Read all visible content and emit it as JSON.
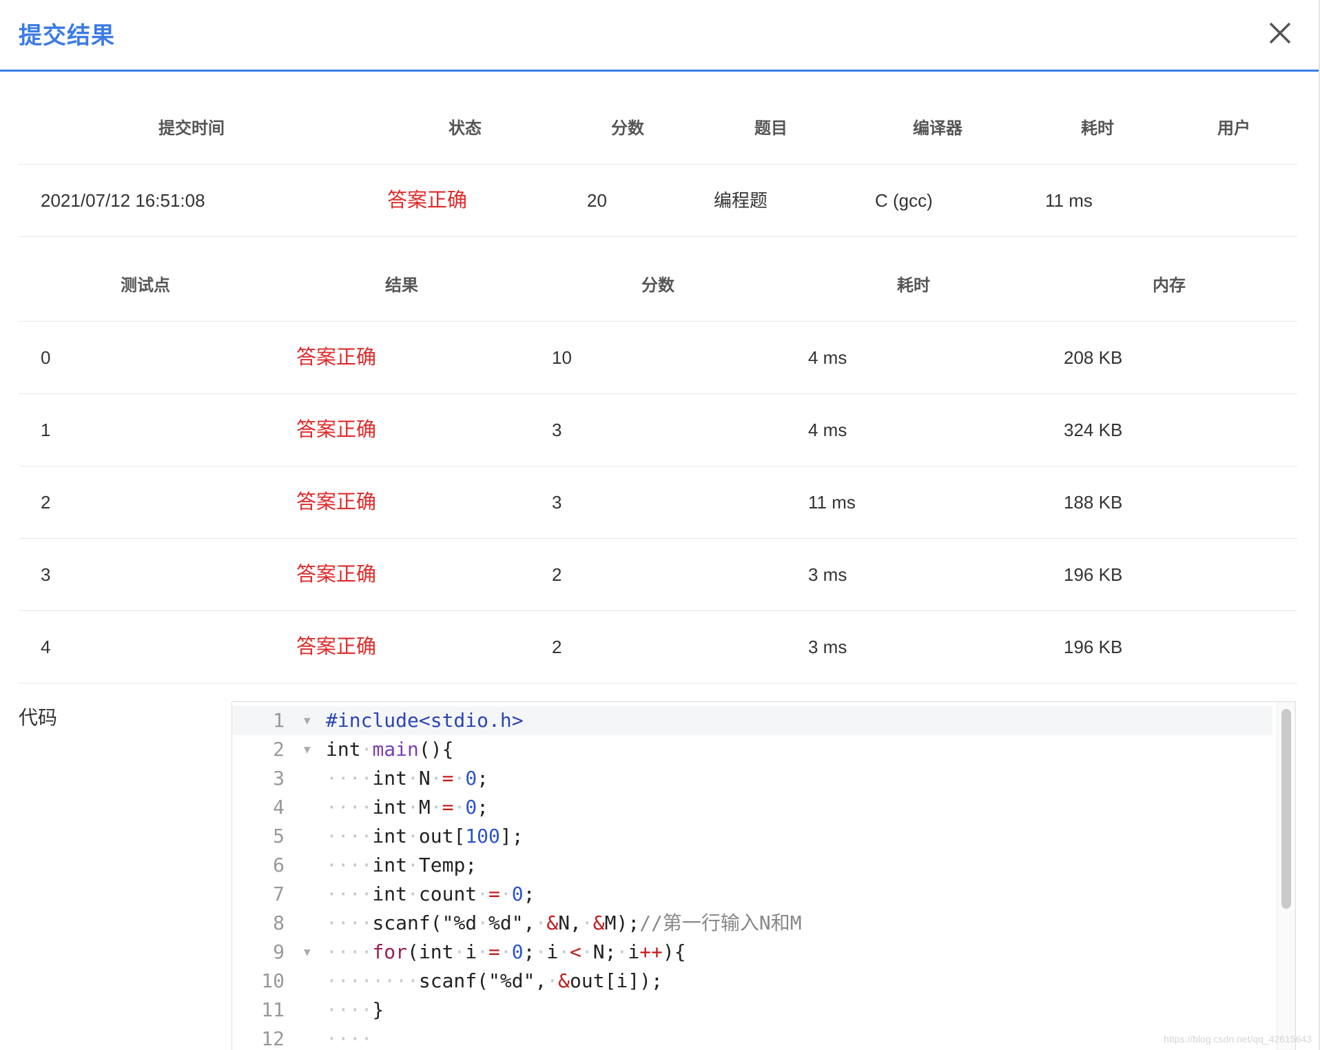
{
  "dialog": {
    "title": "提交结果",
    "close_icon": "close-icon"
  },
  "submission": {
    "headers": [
      "提交时间",
      "状态",
      "分数",
      "题目",
      "编译器",
      "耗时",
      "用户"
    ],
    "row": {
      "time": "2021/07/12 16:51:08",
      "status": "答案正确",
      "score": "20",
      "problem": "编程题",
      "compiler": "C (gcc)",
      "duration": "11 ms",
      "user": ""
    }
  },
  "testcases": {
    "headers": [
      "测试点",
      "结果",
      "分数",
      "耗时",
      "内存"
    ],
    "rows": [
      {
        "id": "0",
        "result": "答案正确",
        "score": "10",
        "time": "4 ms",
        "memory": "208 KB"
      },
      {
        "id": "1",
        "result": "答案正确",
        "score": "3",
        "time": "4 ms",
        "memory": "324 KB"
      },
      {
        "id": "2",
        "result": "答案正确",
        "score": "3",
        "time": "11 ms",
        "memory": "188 KB"
      },
      {
        "id": "3",
        "result": "答案正确",
        "score": "2",
        "time": "3 ms",
        "memory": "196 KB"
      },
      {
        "id": "4",
        "result": "答案正确",
        "score": "2",
        "time": "3 ms",
        "memory": "196 KB"
      }
    ]
  },
  "code": {
    "label": "代码",
    "lines": [
      "#include<stdio.h>",
      "int main(){",
      "    int N = 0;",
      "    int M = 0;",
      "    int out[100];",
      "    int Temp;",
      "    int count = 0;",
      "    scanf(\"%d %d\", &N, &M);//第一行输入N和M",
      "    for(int i = 0; i < N; i++){",
      "        scanf(\"%d\", &out[i]);",
      "    }",
      "    "
    ],
    "line_numbers": [
      "1",
      "2",
      "3",
      "4",
      "5",
      "6",
      "7",
      "8",
      "9",
      "10",
      "11",
      "12"
    ],
    "fold_lines": [
      "1",
      "2",
      "9"
    ]
  },
  "watermark": "https://blog.csdn.net/qq_42615643",
  "colors": {
    "accent": "#3b7be6",
    "success": "#e02a2a"
  }
}
